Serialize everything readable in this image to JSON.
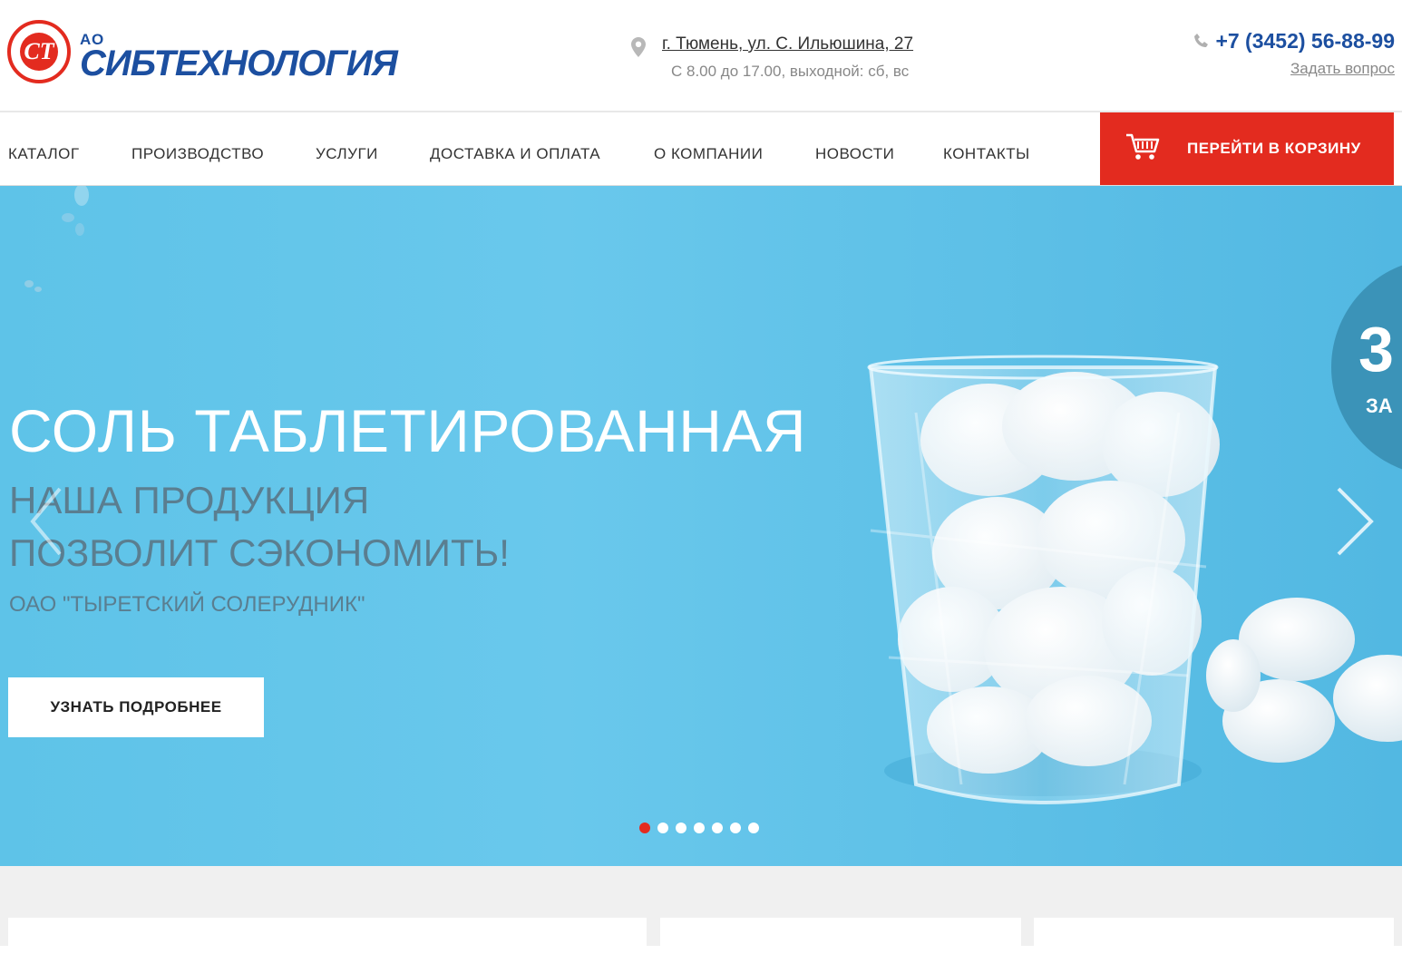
{
  "header": {
    "logo": {
      "prefix": "АО",
      "name": "СИБТЕХНОЛОГИЯ",
      "monogram": "СТ"
    },
    "address": {
      "street": "г. Тюмень, ул. С. Ильюшина, 27",
      "hours": "С 8.00 до 17.00, выходной: сб, вс",
      "icon": "map-pin-icon"
    },
    "contact": {
      "phone": "+7 (3452) 56-88-99",
      "ask": "Задать вопрос",
      "icon": "phone-icon"
    }
  },
  "nav": {
    "items": [
      "КАТАЛОГ",
      "ПРОИЗВОДСТВО",
      "УСЛУГИ",
      "ДОСТАВКА И ОПЛАТА",
      "О КОМПАНИИ",
      "НОВОСТИ",
      "КОНТАКТЫ"
    ],
    "cart": {
      "label": "ПЕРЕЙТИ В КОРЗИНУ",
      "icon": "cart-icon"
    }
  },
  "hero": {
    "title": "СОЛЬ ТАБЛЕТИРОВАННАЯ",
    "subtitle_line1": "НАША ПРОДУКЦИЯ",
    "subtitle_line2": "ПОЗВОЛИТ СЭКОНОМИТЬ!",
    "company": "ОАО \"ТЫРЕТСКИЙ СОЛЕРУДНИК\"",
    "button": "УЗНАТЬ ПОДРОБНЕЕ",
    "badge_big": "3",
    "badge_small": "ЗА",
    "slides_total": 7,
    "active_slide": 1
  },
  "colors": {
    "brand_red": "#e32b1f",
    "brand_blue": "#1c4fa0",
    "hero_bg": "#5ec3e8"
  }
}
